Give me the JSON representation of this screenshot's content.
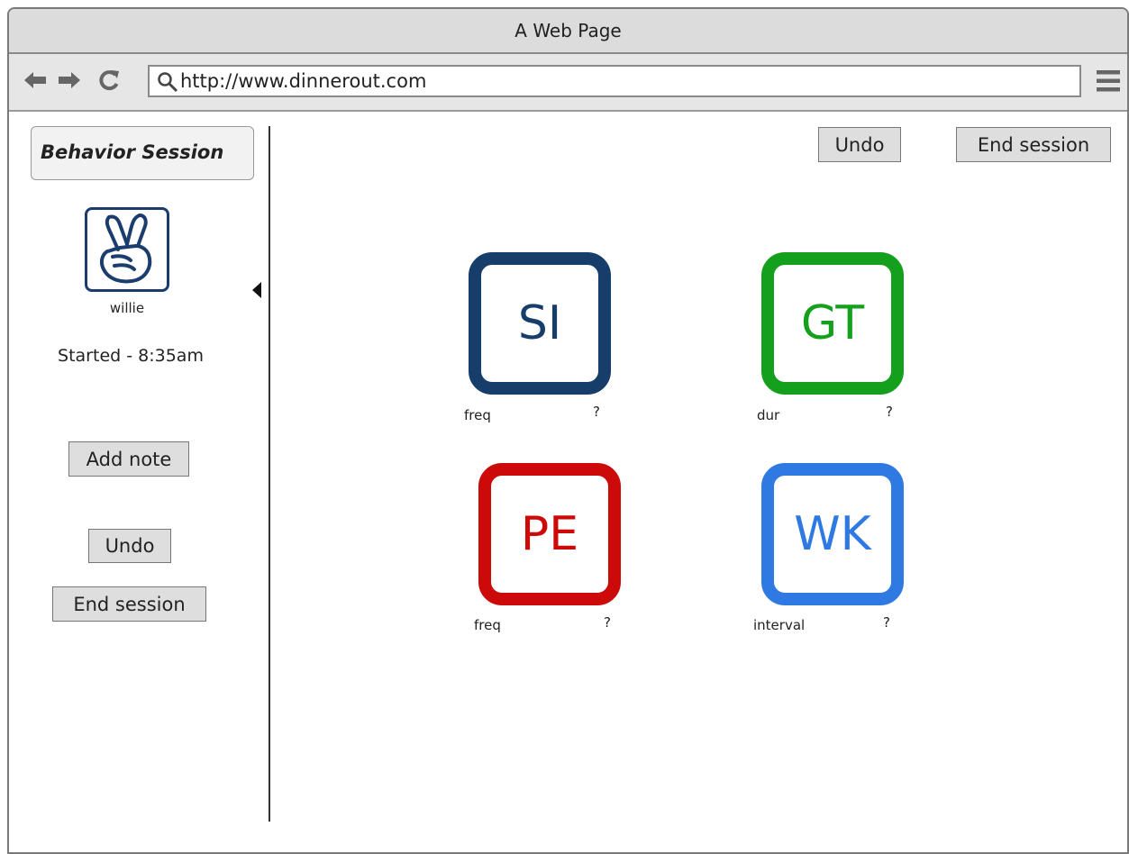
{
  "window": {
    "title": "A Web Page"
  },
  "browser": {
    "url": "http://www.dinnerout.com"
  },
  "sidebar": {
    "header": "Behavior Session",
    "user_name": "willie",
    "started_text": "Started - 8:35am",
    "add_note_label": "Add note",
    "undo_label": "Undo",
    "end_session_label": "End session"
  },
  "toolbar": {
    "undo_label": "Undo",
    "end_session_label": "End session"
  },
  "behaviors": [
    {
      "code": "SI",
      "type": "freq",
      "help": "?",
      "color": "#173d6b"
    },
    {
      "code": "GT",
      "type": "dur",
      "help": "?",
      "color": "#14a01c"
    },
    {
      "code": "PE",
      "type": "freq",
      "help": "?",
      "color": "#cc0a0a"
    },
    {
      "code": "WK",
      "type": "interval",
      "help": "?",
      "color": "#2f79e2"
    }
  ]
}
